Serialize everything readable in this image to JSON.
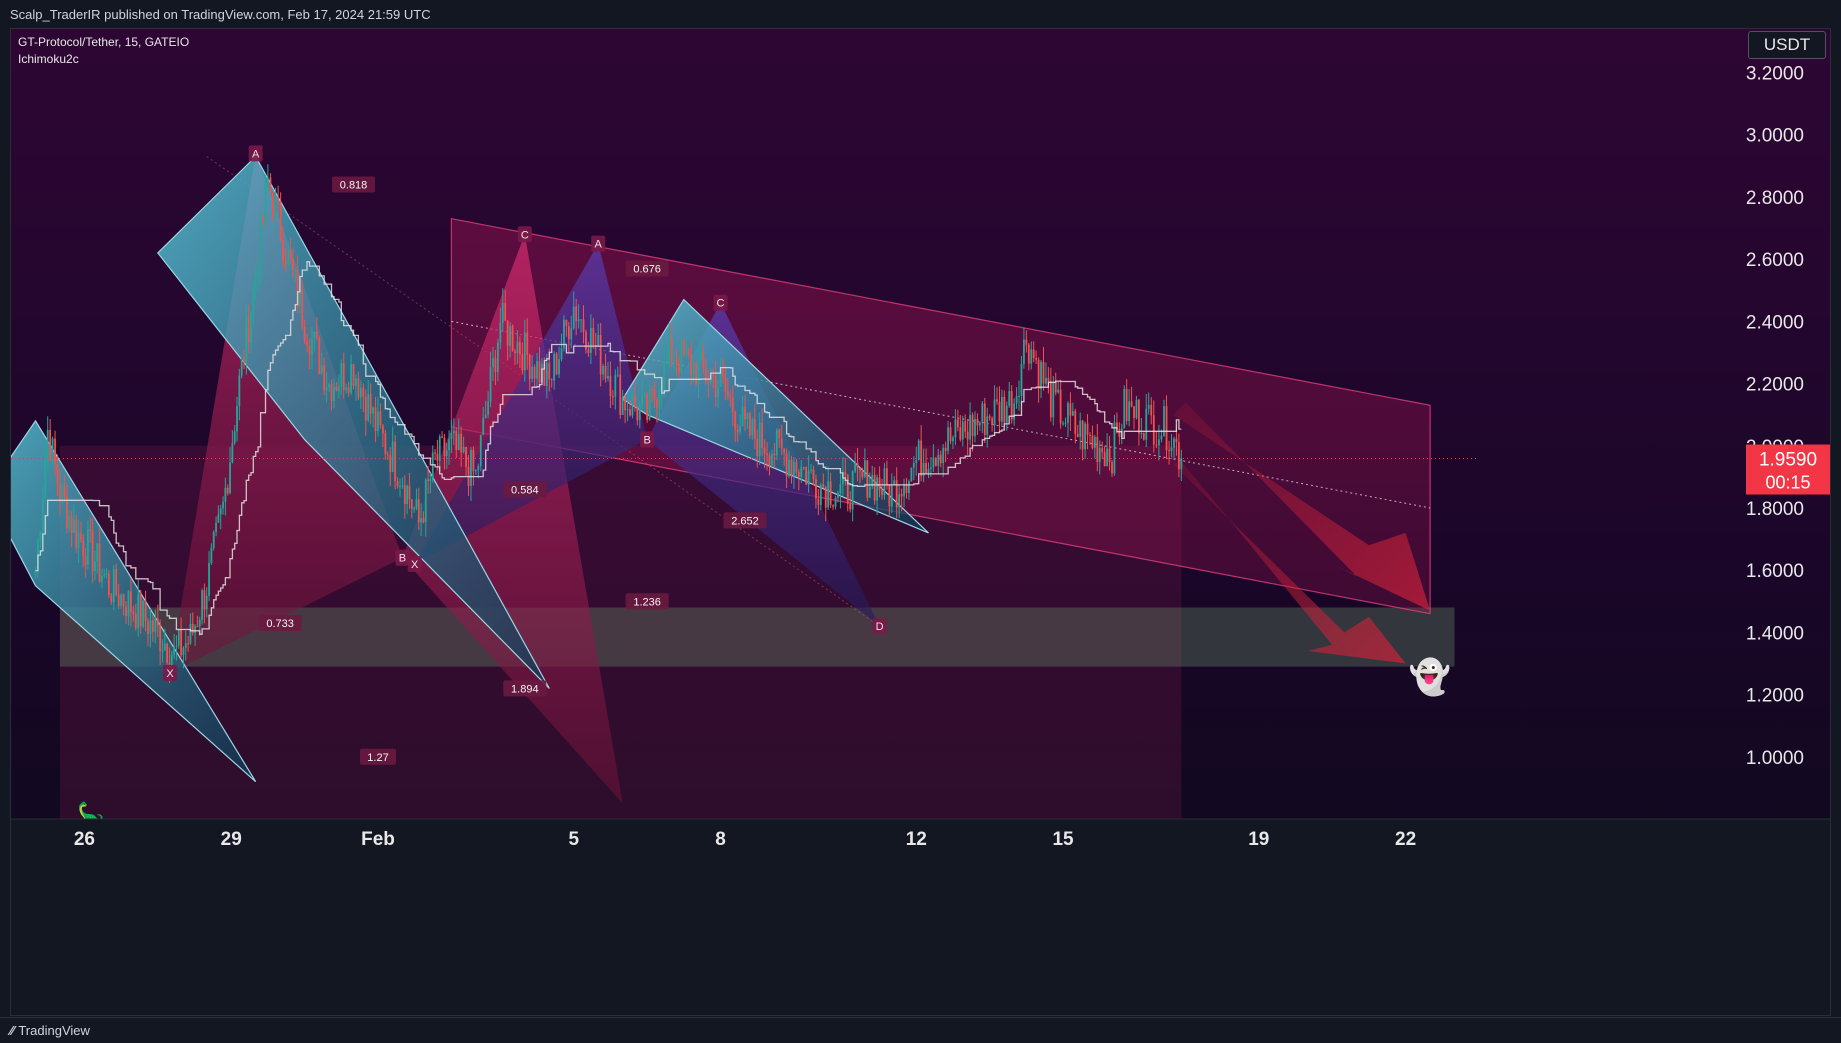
{
  "header": {
    "published_text": "Scalp_TraderIR published on TradingView.com, Feb 17, 2024 21:59 UTC"
  },
  "legend": {
    "symbol_line": "GT-Protocol/Tether, 15, GATEIO",
    "indicator": "Ichimoku2c"
  },
  "currency_button": "USDT",
  "price_tag": {
    "price": "1.9590",
    "countdown": "00:15",
    "color": "#f23645"
  },
  "footer": {
    "brand": "TradingView"
  },
  "colors": {
    "background_top": "#2e0634",
    "background_bottom": "#0b0a1a",
    "channel_fill": "#c2185b",
    "cyan_pattern": "#4fb0c6",
    "pink_pattern": "#b0265f",
    "purple_pattern": "#4a2a8a",
    "green_zone": "#6b8f6b",
    "candle_up": "#26a69a",
    "candle_down": "#ef5350",
    "kijun_line": "#e0e0e0"
  },
  "chart_data": {
    "type": "candlestick",
    "title": "",
    "xlabel": "",
    "ylabel": "",
    "y_axis": {
      "ticks": [
        "3.2000",
        "3.0000",
        "2.8000",
        "2.6000",
        "2.4000",
        "2.2000",
        "2.0000",
        "1.8000",
        "1.6000",
        "1.4000",
        "1.2000",
        "1.0000"
      ],
      "range": [
        0.8,
        3.34
      ]
    },
    "x_axis": {
      "ticks": [
        "26",
        "29",
        "Feb",
        "5",
        "8",
        "12",
        "15",
        "19",
        "22"
      ],
      "range": [
        "2024-01-25",
        "2024-02-24"
      ]
    },
    "last_price": 1.959,
    "series": [
      {
        "name": "",
        "kind": "close",
        "points": [
          [
            "2024-01-25T12:00",
            1.6
          ],
          [
            "2024-01-25T18:00",
            2.05
          ],
          [
            "2024-01-26T00:00",
            1.85
          ],
          [
            "2024-01-26T08:00",
            1.72
          ],
          [
            "2024-01-26T16:00",
            1.65
          ],
          [
            "2024-01-27T00:00",
            1.55
          ],
          [
            "2024-01-27T12:00",
            1.48
          ],
          [
            "2024-01-28T00:00",
            1.4
          ],
          [
            "2024-01-28T08:00",
            1.33
          ],
          [
            "2024-01-28T16:00",
            1.38
          ],
          [
            "2024-01-29T00:00",
            1.55
          ],
          [
            "2024-01-29T08:00",
            1.8
          ],
          [
            "2024-01-29T16:00",
            2.2
          ],
          [
            "2024-01-30T00:00",
            2.55
          ],
          [
            "2024-01-30T06:00",
            2.85
          ],
          [
            "2024-01-30T16:00",
            2.6
          ],
          [
            "2024-01-31T00:00",
            2.4
          ],
          [
            "2024-01-31T12:00",
            2.2
          ],
          [
            "2024-02-01T00:00",
            2.25
          ],
          [
            "2024-02-01T12:00",
            2.05
          ],
          [
            "2024-02-02T00:00",
            1.9
          ],
          [
            "2024-02-02T08:00",
            1.75
          ],
          [
            "2024-02-02T16:00",
            1.95
          ],
          [
            "2024-02-03T00:00",
            2.0
          ],
          [
            "2024-02-03T12:00",
            1.9
          ],
          [
            "2024-02-04T00:00",
            2.4
          ],
          [
            "2024-02-04T12:00",
            2.3
          ],
          [
            "2024-02-05T00:00",
            2.2
          ],
          [
            "2024-02-05T12:00",
            2.45
          ],
          [
            "2024-02-06T00:00",
            2.3
          ],
          [
            "2024-02-06T12:00",
            2.15
          ],
          [
            "2024-02-07T00:00",
            2.1
          ],
          [
            "2024-02-07T12:00",
            2.3
          ],
          [
            "2024-02-08T00:00",
            2.25
          ],
          [
            "2024-02-08T12:00",
            2.2
          ],
          [
            "2024-02-09T00:00",
            2.05
          ],
          [
            "2024-02-09T12:00",
            2.0
          ],
          [
            "2024-02-10T00:00",
            1.95
          ],
          [
            "2024-02-10T12:00",
            1.88
          ],
          [
            "2024-02-11T00:00",
            1.85
          ],
          [
            "2024-02-11T12:00",
            1.9
          ],
          [
            "2024-02-12T00:00",
            1.85
          ],
          [
            "2024-02-12T12:00",
            1.95
          ],
          [
            "2024-02-13T00:00",
            2.0
          ],
          [
            "2024-02-13T12:00",
            2.05
          ],
          [
            "2024-02-14T00:00",
            2.1
          ],
          [
            "2024-02-14T12:00",
            2.15
          ],
          [
            "2024-02-14T18:00",
            2.35
          ],
          [
            "2024-02-15T06:00",
            2.15
          ],
          [
            "2024-02-15T18:00",
            2.05
          ],
          [
            "2024-02-16T06:00",
            2.0
          ],
          [
            "2024-02-16T12:00",
            1.98
          ],
          [
            "2024-02-16T18:00",
            2.12
          ],
          [
            "2024-02-17T06:00",
            2.08
          ],
          [
            "2024-02-17T16:00",
            2.05
          ],
          [
            "2024-02-17T22:00",
            1.96
          ]
        ]
      }
    ],
    "annotations": {
      "pattern_points": [
        {
          "label": "A",
          "date": "2024-01-30T00:00",
          "price": 2.94
        },
        {
          "label": "X",
          "date": "2024-01-28T06:00",
          "price": 1.27
        },
        {
          "label": "B",
          "date": "2024-02-02T00:00",
          "price": 1.64
        },
        {
          "label": "X",
          "date": "2024-02-02T06:00",
          "price": 1.62
        },
        {
          "label": "C",
          "date": "2024-02-04T12:00",
          "price": 2.68
        },
        {
          "label": "A",
          "date": "2024-02-06T00:00",
          "price": 2.65
        },
        {
          "label": "C",
          "date": "2024-02-08T12:00",
          "price": 2.46
        },
        {
          "label": "B",
          "date": "2024-02-07T00:00",
          "price": 2.02
        },
        {
          "label": "D",
          "date": "2024-02-11T18:00",
          "price": 1.42
        }
      ],
      "fib_ratios": [
        {
          "label": "0.818",
          "date": "2024-02-01T00:00",
          "price": 2.84
        },
        {
          "label": "0.676",
          "date": "2024-02-07T00:00",
          "price": 2.57
        },
        {
          "label": "0.584",
          "date": "2024-02-04T12:00",
          "price": 1.86
        },
        {
          "label": "2.652",
          "date": "2024-02-09T00:00",
          "price": 1.76
        },
        {
          "label": "1.236",
          "date": "2024-02-07T00:00",
          "price": 1.5
        },
        {
          "label": "0.733",
          "date": "2024-01-30T12:00",
          "price": 1.43
        },
        {
          "label": "1.894",
          "date": "2024-02-04T12:00",
          "price": 1.22
        },
        {
          "label": "1.27",
          "date": "2024-02-01T12:00",
          "price": 1.0
        }
      ],
      "zone": {
        "from_price": 1.29,
        "to_price": 1.48
      }
    }
  }
}
